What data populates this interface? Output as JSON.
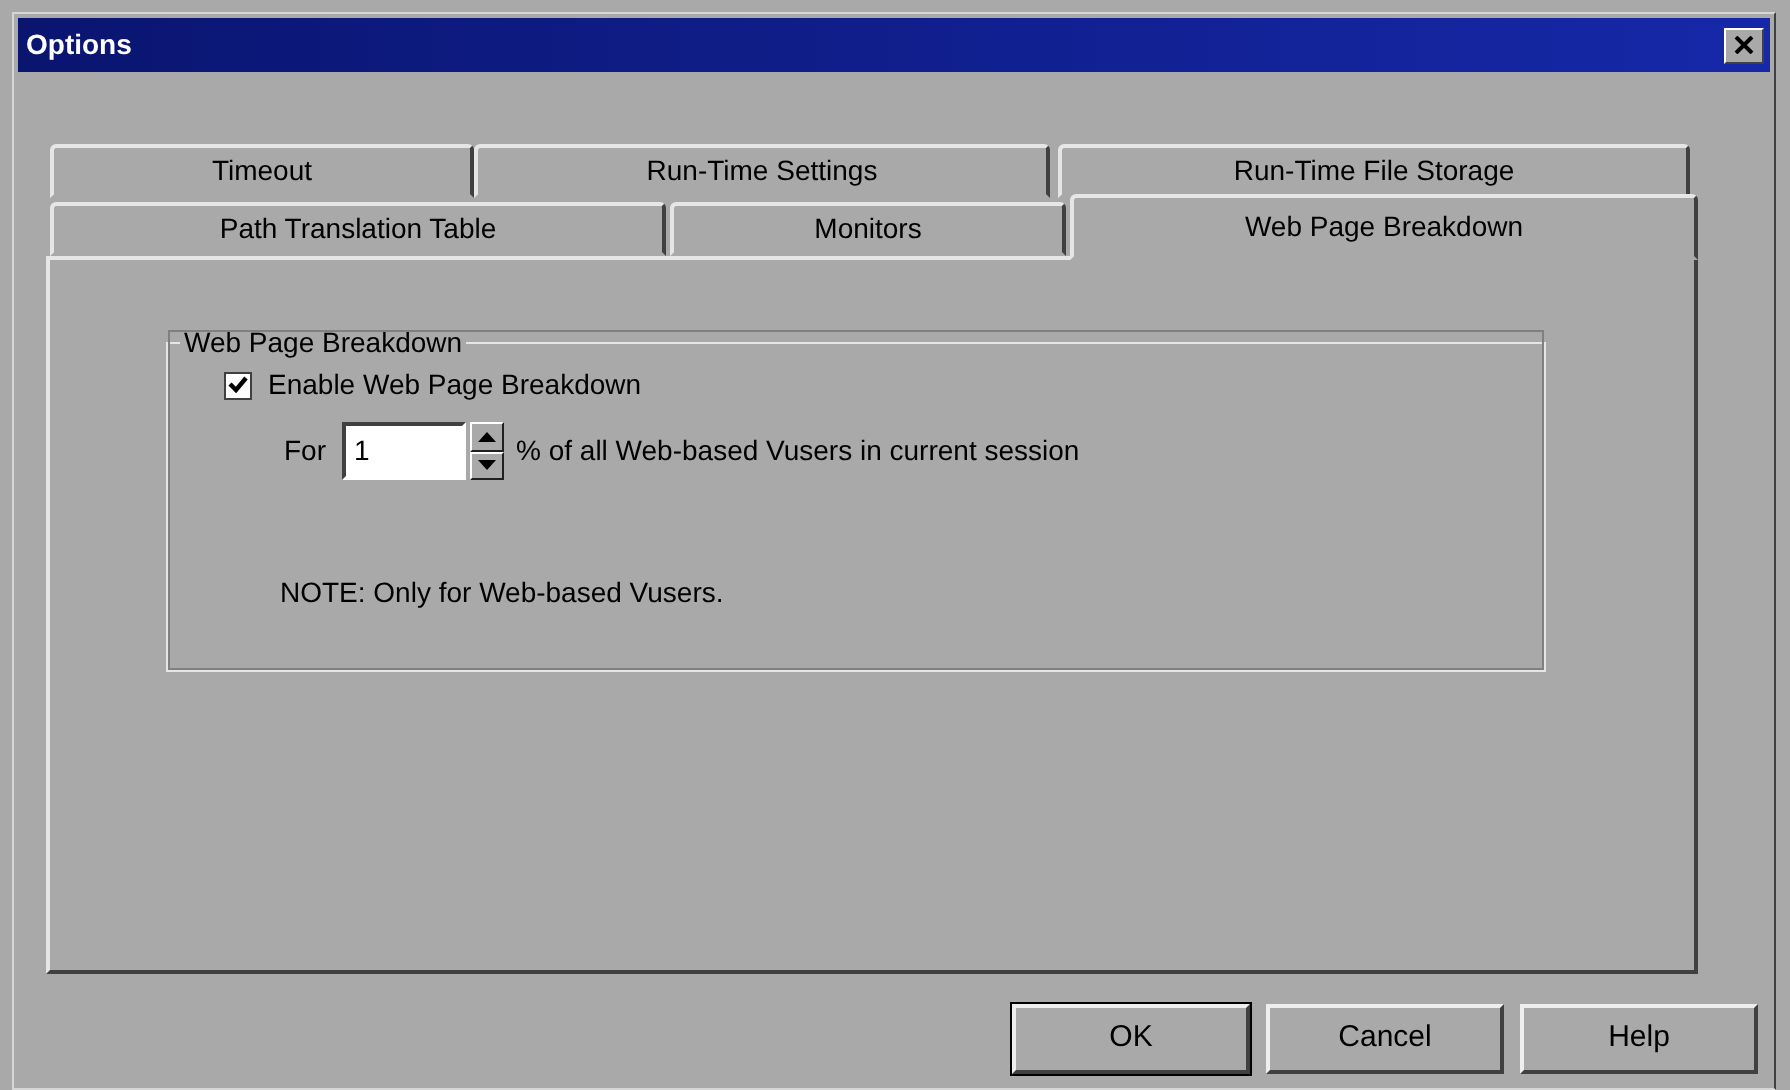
{
  "window": {
    "title": "Options"
  },
  "tab_rows": [
    [
      {
        "label": "Timeout",
        "selected": false
      },
      {
        "label": "Run-Time Settings",
        "selected": false
      },
      {
        "label": "Run-Time File Storage",
        "selected": false
      }
    ],
    [
      {
        "label": "Path Translation Table",
        "selected": false
      },
      {
        "label": "Monitors",
        "selected": false
      },
      {
        "label": "Web Page Breakdown",
        "selected": true
      }
    ]
  ],
  "group": {
    "title": "Web Page Breakdown",
    "checkbox": {
      "label": "Enable Web Page Breakdown",
      "checked": true
    },
    "spin": {
      "label": "For",
      "value": "1",
      "suffix": "% of all Web-based Vusers in current session"
    },
    "note": "NOTE: Only for Web-based Vusers."
  },
  "buttons": [
    {
      "label": "OK",
      "default": true
    },
    {
      "label": "Cancel",
      "default": false
    },
    {
      "label": "Help",
      "default": false
    }
  ]
}
